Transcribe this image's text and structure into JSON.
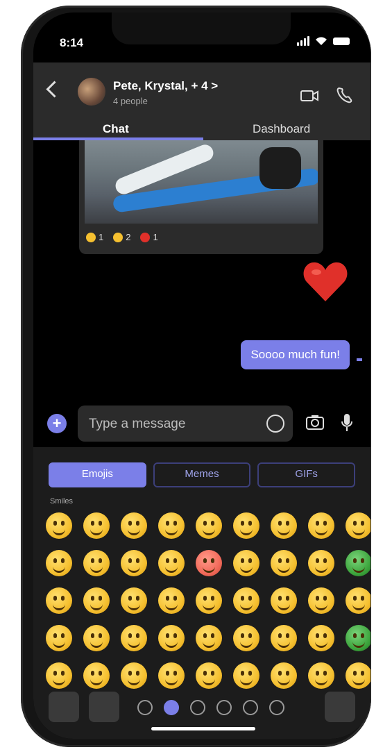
{
  "status": {
    "time": "8:14"
  },
  "header": {
    "title": "Pete, Krystal, + 4 >",
    "subtitle": "4 people",
    "tabs": [
      "Chat",
      "Dashboard"
    ]
  },
  "chat": {
    "reactions": [
      {
        "icon": "thumbs-up-icon",
        "count": "1"
      },
      {
        "icon": "laugh-icon",
        "count": "2"
      },
      {
        "icon": "heart-icon",
        "count": "1"
      }
    ],
    "message": "Soooo much fun!"
  },
  "compose": {
    "placeholder": "Type a message"
  },
  "picker": {
    "tabs": [
      "Emojis",
      "Memes",
      "GIFs"
    ],
    "category_label": "Smiles"
  },
  "colors": {
    "accent": "#7b7fe8",
    "header_bg": "#2b2b2b",
    "background": "#000000"
  }
}
